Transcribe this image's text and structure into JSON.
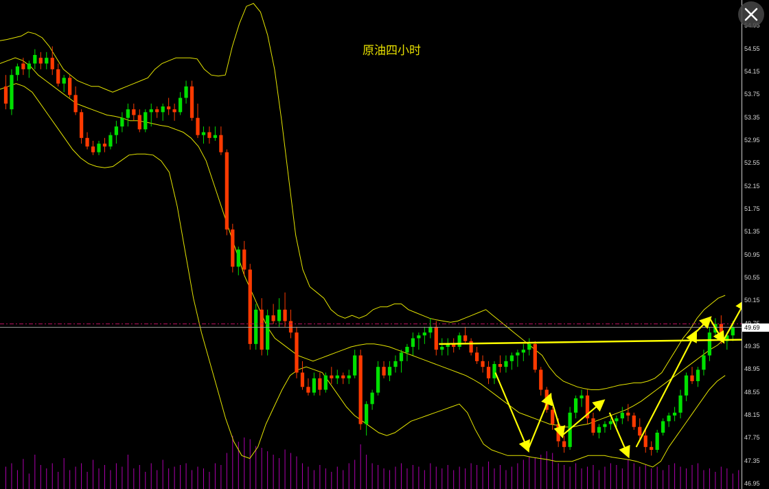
{
  "chart_data": {
    "type": "candlestick",
    "title": "原油四小时",
    "ylim": [
      46.95,
      55.35
    ],
    "y_ticks": [
      "54.95",
      "54.55",
      "54.15",
      "53.75",
      "53.35",
      "52.95",
      "52.55",
      "52.15",
      "51.75",
      "51.35",
      "50.95",
      "50.55",
      "50.15",
      "49.75",
      "49.35",
      "48.95",
      "48.55",
      "48.15",
      "47.75",
      "47.35",
      "46.95"
    ],
    "last_price_label": "49.69",
    "last_price": 49.69,
    "dashed_level": 49.75,
    "up_color": "#00e000",
    "down_color": "#ff3a00",
    "band_color": "#e6e600",
    "volume_color": "#b000b0",
    "arrow_color": "#ffff00",
    "candles": [
      [
        53.9,
        54.1,
        53.5,
        53.6
      ],
      [
        53.5,
        54.2,
        53.4,
        54.1
      ],
      [
        54.1,
        54.3,
        54.0,
        54.25
      ],
      [
        54.3,
        54.4,
        54.1,
        54.2
      ],
      [
        54.2,
        54.35,
        54.05,
        54.3
      ],
      [
        54.3,
        54.55,
        54.2,
        54.45
      ],
      [
        54.4,
        54.5,
        54.2,
        54.3
      ],
      [
        54.3,
        54.5,
        54.2,
        54.4
      ],
      [
        54.4,
        54.6,
        54.1,
        54.2
      ],
      [
        54.2,
        54.3,
        53.9,
        53.95
      ],
      [
        53.95,
        54.1,
        53.8,
        54.05
      ],
      [
        54.05,
        54.1,
        53.7,
        53.75
      ],
      [
        53.75,
        53.9,
        53.4,
        53.45
      ],
      [
        53.45,
        53.5,
        52.9,
        53.0
      ],
      [
        53.0,
        53.1,
        52.8,
        52.85
      ],
      [
        52.85,
        52.95,
        52.7,
        52.75
      ],
      [
        52.75,
        52.95,
        52.7,
        52.9
      ],
      [
        52.9,
        53.0,
        52.75,
        52.85
      ],
      [
        52.85,
        53.1,
        52.8,
        53.05
      ],
      [
        53.05,
        53.3,
        52.9,
        53.2
      ],
      [
        53.2,
        53.45,
        53.1,
        53.35
      ],
      [
        53.35,
        53.6,
        53.2,
        53.5
      ],
      [
        53.5,
        53.6,
        53.3,
        53.4
      ],
      [
        53.4,
        53.5,
        53.1,
        53.15
      ],
      [
        53.15,
        53.5,
        53.1,
        53.45
      ],
      [
        53.45,
        53.6,
        53.2,
        53.5
      ],
      [
        53.5,
        53.55,
        53.35,
        53.45
      ],
      [
        53.45,
        53.6,
        53.3,
        53.55
      ],
      [
        53.55,
        53.7,
        53.4,
        53.5
      ],
      [
        53.5,
        53.6,
        53.3,
        53.45
      ],
      [
        53.45,
        53.8,
        53.4,
        53.7
      ],
      [
        53.7,
        54.0,
        53.6,
        53.9
      ],
      [
        53.9,
        54.0,
        53.3,
        53.35
      ],
      [
        53.35,
        53.6,
        53.0,
        53.05
      ],
      [
        53.05,
        53.2,
        52.9,
        53.1
      ],
      [
        53.1,
        53.2,
        52.9,
        53.0
      ],
      [
        53.0,
        53.2,
        52.95,
        53.05
      ],
      [
        53.05,
        53.2,
        52.7,
        52.75
      ],
      [
        52.75,
        52.8,
        51.3,
        51.4
      ],
      [
        51.4,
        51.5,
        50.65,
        50.75
      ],
      [
        50.75,
        51.1,
        50.6,
        51.05
      ],
      [
        51.05,
        51.2,
        50.6,
        50.7
      ],
      [
        50.7,
        50.8,
        49.3,
        49.4
      ],
      [
        49.4,
        50.1,
        49.3,
        50.0
      ],
      [
        50.0,
        50.2,
        49.2,
        49.3
      ],
      [
        49.3,
        50.0,
        49.2,
        49.9
      ],
      [
        49.9,
        50.1,
        49.75,
        49.8
      ],
      [
        49.8,
        50.2,
        49.7,
        50.0
      ],
      [
        50.0,
        50.3,
        49.7,
        49.8
      ],
      [
        49.8,
        50.0,
        49.5,
        49.6
      ],
      [
        49.6,
        49.7,
        48.8,
        48.9
      ],
      [
        48.9,
        49.1,
        48.6,
        48.65
      ],
      [
        48.65,
        48.8,
        48.5,
        48.55
      ],
      [
        48.55,
        48.9,
        48.5,
        48.8
      ],
      [
        48.8,
        48.9,
        48.5,
        48.6
      ],
      [
        48.6,
        48.9,
        48.55,
        48.85
      ],
      [
        48.85,
        49.0,
        48.7,
        48.8
      ],
      [
        48.8,
        48.95,
        48.7,
        48.85
      ],
      [
        48.85,
        48.9,
        48.7,
        48.8
      ],
      [
        48.8,
        48.95,
        48.7,
        48.85
      ],
      [
        48.85,
        49.3,
        48.8,
        49.2
      ],
      [
        49.2,
        49.3,
        47.9,
        48.0
      ],
      [
        48.0,
        48.4,
        47.8,
        48.35
      ],
      [
        48.35,
        48.6,
        48.25,
        48.55
      ],
      [
        48.55,
        49.1,
        48.5,
        49.0
      ],
      [
        49.0,
        49.1,
        48.8,
        48.85
      ],
      [
        48.85,
        49.1,
        48.75,
        49.0
      ],
      [
        49.0,
        49.2,
        48.9,
        49.1
      ],
      [
        49.1,
        49.3,
        48.9,
        49.25
      ],
      [
        49.25,
        49.4,
        49.1,
        49.35
      ],
      [
        49.35,
        49.6,
        49.2,
        49.5
      ],
      [
        49.5,
        49.6,
        49.3,
        49.55
      ],
      [
        49.55,
        49.7,
        49.4,
        49.6
      ],
      [
        49.6,
        49.85,
        49.5,
        49.7
      ],
      [
        49.7,
        49.8,
        49.2,
        49.3
      ],
      [
        49.3,
        49.5,
        49.2,
        49.35
      ],
      [
        49.35,
        49.5,
        49.2,
        49.4
      ],
      [
        49.4,
        49.5,
        49.25,
        49.35
      ],
      [
        49.35,
        49.6,
        49.3,
        49.55
      ],
      [
        49.55,
        49.7,
        49.4,
        49.45
      ],
      [
        49.45,
        49.5,
        49.2,
        49.25
      ],
      [
        49.25,
        49.35,
        49.05,
        49.1
      ],
      [
        49.1,
        49.2,
        48.9,
        49.0
      ],
      [
        49.0,
        49.1,
        48.7,
        48.8
      ],
      [
        48.8,
        49.1,
        48.7,
        49.05
      ],
      [
        49.05,
        49.2,
        48.9,
        49.0
      ],
      [
        49.0,
        49.2,
        48.9,
        49.1
      ],
      [
        49.1,
        49.25,
        48.95,
        49.2
      ],
      [
        49.2,
        49.3,
        49.0,
        49.25
      ],
      [
        49.25,
        49.4,
        49.1,
        49.3
      ],
      [
        49.3,
        49.5,
        49.2,
        49.4
      ],
      [
        49.4,
        49.45,
        48.9,
        48.95
      ],
      [
        48.95,
        49.0,
        48.5,
        48.6
      ],
      [
        48.6,
        48.65,
        48.2,
        48.25
      ],
      [
        48.25,
        48.3,
        47.9,
        48.0
      ],
      [
        48.0,
        48.1,
        47.6,
        47.7
      ],
      [
        47.7,
        47.8,
        47.5,
        47.6
      ],
      [
        47.6,
        48.3,
        47.55,
        48.2
      ],
      [
        48.2,
        48.5,
        48.1,
        48.45
      ],
      [
        48.45,
        48.6,
        48.3,
        48.5
      ],
      [
        48.5,
        48.6,
        48.0,
        48.1
      ],
      [
        48.1,
        48.2,
        47.8,
        47.85
      ],
      [
        47.85,
        48.0,
        47.75,
        47.95
      ],
      [
        47.95,
        48.05,
        47.85,
        48.0
      ],
      [
        48.0,
        48.1,
        47.9,
        48.05
      ],
      [
        48.05,
        48.15,
        47.95,
        48.1
      ],
      [
        48.1,
        48.3,
        48.0,
        48.2
      ],
      [
        48.2,
        48.35,
        48.05,
        48.15
      ],
      [
        48.15,
        48.2,
        47.9,
        47.95
      ],
      [
        47.95,
        48.1,
        47.7,
        47.8
      ],
      [
        47.8,
        47.9,
        47.5,
        47.6
      ],
      [
        47.6,
        47.7,
        47.45,
        47.55
      ],
      [
        47.55,
        47.9,
        47.5,
        47.85
      ],
      [
        47.85,
        48.1,
        47.8,
        48.05
      ],
      [
        48.05,
        48.2,
        47.95,
        48.15
      ],
      [
        48.15,
        48.3,
        48.05,
        48.2
      ],
      [
        48.2,
        48.6,
        48.1,
        48.5
      ],
      [
        48.5,
        48.9,
        48.4,
        48.85
      ],
      [
        48.85,
        49.0,
        48.7,
        48.75
      ],
      [
        48.75,
        49.0,
        48.65,
        48.95
      ],
      [
        48.95,
        49.3,
        48.85,
        49.2
      ],
      [
        49.2,
        49.7,
        49.1,
        49.6
      ],
      [
        49.6,
        49.85,
        49.5,
        49.75
      ],
      [
        49.75,
        49.9,
        49.4,
        49.45
      ],
      [
        49.45,
        49.6,
        49.3,
        49.55
      ],
      [
        49.55,
        49.8,
        49.45,
        49.69
      ]
    ],
    "volumes": [
      26,
      30,
      22,
      35,
      18,
      40,
      28,
      24,
      30,
      20,
      36,
      22,
      26,
      30,
      20,
      34,
      24,
      28,
      22,
      30,
      26,
      40,
      24,
      28,
      20,
      30,
      22,
      34,
      24,
      26,
      28,
      30,
      22,
      26,
      24,
      20,
      30,
      28,
      42,
      62,
      55,
      60,
      58,
      50,
      48,
      44,
      40,
      36,
      46,
      42,
      38,
      30,
      26,
      22,
      28,
      24,
      20,
      26,
      22,
      30,
      34,
      52,
      40,
      30,
      28,
      24,
      22,
      26,
      30,
      24,
      28,
      26,
      22,
      30,
      26,
      24,
      28,
      22,
      26,
      24,
      30,
      28,
      26,
      32,
      24,
      28,
      22,
      26,
      30,
      34,
      38,
      36,
      40,
      44,
      42,
      30,
      28,
      26,
      30,
      24,
      26,
      28,
      22,
      26,
      30,
      28,
      24,
      34,
      30,
      26,
      28,
      24,
      26,
      22,
      28,
      30,
      26,
      24,
      28,
      30,
      22,
      24,
      20,
      26,
      24,
      18,
      22
    ],
    "bands": {
      "upper": [
        54.7,
        54.72,
        54.75,
        54.78,
        54.85,
        54.82,
        54.75,
        54.6,
        54.4,
        54.2,
        54.1,
        54.0,
        53.95,
        53.9,
        53.9,
        53.85,
        53.8,
        53.85,
        53.9,
        53.95,
        54.0,
        54.05,
        54.2,
        54.3,
        54.35,
        54.4,
        54.4,
        54.4,
        54.38,
        54.2,
        54.1,
        54.08,
        54.1,
        54.6,
        55.0,
        55.3,
        55.35,
        55.2,
        54.8,
        54.2,
        53.3,
        52.3,
        51.3,
        50.7,
        50.4,
        50.3,
        50.2,
        50.0,
        49.9,
        49.85,
        49.9,
        49.85,
        49.9,
        50.0,
        50.05,
        50.05,
        50.1,
        50.1,
        50.0,
        49.95,
        49.9,
        49.85,
        49.82,
        49.8,
        49.78,
        49.8,
        49.85,
        49.9,
        49.95,
        50.0,
        49.9,
        49.8,
        49.7,
        49.6,
        49.5,
        49.4,
        49.3,
        49.2,
        49.0,
        48.85,
        48.75,
        48.7,
        48.65,
        48.62,
        48.6,
        48.6,
        48.62,
        48.65,
        48.68,
        48.7,
        48.72,
        48.72,
        48.75,
        48.8,
        48.9,
        49.1,
        49.3,
        49.5,
        49.65,
        49.85,
        50.0,
        50.1,
        50.2,
        50.25
      ],
      "mid": [
        54.3,
        54.35,
        54.4,
        54.35,
        54.25,
        54.1,
        54.0,
        53.9,
        53.8,
        53.7,
        53.6,
        53.55,
        53.5,
        53.45,
        53.4,
        53.38,
        53.35,
        53.3,
        53.3,
        53.28,
        53.25,
        53.22,
        53.2,
        53.15,
        53.1,
        53.0,
        52.85,
        52.6,
        52.2,
        51.8,
        51.4,
        51.0,
        50.6,
        50.3,
        50.0,
        49.7,
        49.5,
        49.4,
        49.3,
        49.2,
        49.15,
        49.1,
        49.15,
        49.2,
        49.25,
        49.3,
        49.35,
        49.38,
        49.4,
        49.4,
        49.38,
        49.35,
        49.3,
        49.25,
        49.2,
        49.15,
        49.1,
        49.05,
        49.0,
        48.95,
        48.9,
        48.85,
        48.78,
        48.7,
        48.6,
        48.5,
        48.4,
        48.3,
        48.2,
        48.15,
        48.1,
        48.05,
        48.0,
        47.98,
        47.95,
        47.95,
        47.98,
        48.0,
        48.05,
        48.1,
        48.15,
        48.2,
        48.25,
        48.32,
        48.4,
        48.5,
        48.6,
        48.7,
        48.8,
        48.9,
        49.0,
        49.1,
        49.2,
        49.3,
        49.38,
        49.5
      ],
      "lower": [
        53.85,
        53.9,
        53.95,
        53.9,
        53.8,
        53.6,
        53.4,
        53.2,
        53.0,
        52.8,
        52.65,
        52.55,
        52.5,
        52.48,
        52.5,
        52.6,
        52.7,
        52.72,
        52.72,
        52.7,
        52.6,
        52.4,
        51.8,
        51.0,
        50.2,
        49.6,
        49.1,
        48.6,
        48.1,
        47.7,
        47.45,
        47.4,
        47.6,
        48.0,
        48.3,
        48.6,
        48.85,
        48.95,
        49.0,
        48.95,
        48.9,
        48.7,
        48.5,
        48.3,
        48.15,
        48.05,
        47.95,
        47.85,
        47.8,
        47.85,
        47.95,
        48.05,
        48.1,
        48.15,
        48.2,
        48.25,
        48.3,
        48.35,
        48.2,
        47.9,
        47.65,
        47.55,
        47.5,
        47.45,
        47.45,
        47.45,
        47.42,
        47.4,
        47.38,
        47.35,
        47.35,
        47.35,
        47.4,
        47.45,
        47.45,
        47.45,
        47.42,
        47.4,
        47.38,
        47.35,
        47.3,
        47.25,
        47.35,
        47.6,
        47.8,
        48.0,
        48.2,
        48.4,
        48.6,
        48.75,
        48.85
      ]
    },
    "horizontal_line": {
      "x_start_frac": 0.592,
      "y_start": 49.4,
      "y_end": 49.48
    },
    "zigzag_arrows": [
      [
        [
          0.668,
          48.9
        ],
        [
          0.712,
          47.55
        ],
        [
          0.742,
          48.5
        ],
        [
          0.758,
          47.8
        ],
        [
          0.813,
          48.4
        ]
      ],
      [
        [
          0.822,
          48.2
        ],
        [
          0.847,
          47.45
        ]
      ],
      [
        [
          0.858,
          47.6
        ],
        [
          0.938,
          49.6
        ],
        [
          0.957,
          49.85
        ],
        [
          0.975,
          49.45
        ],
        [
          1.005,
          50.15
        ]
      ]
    ]
  },
  "ui": {
    "close_icon": "close-icon"
  }
}
